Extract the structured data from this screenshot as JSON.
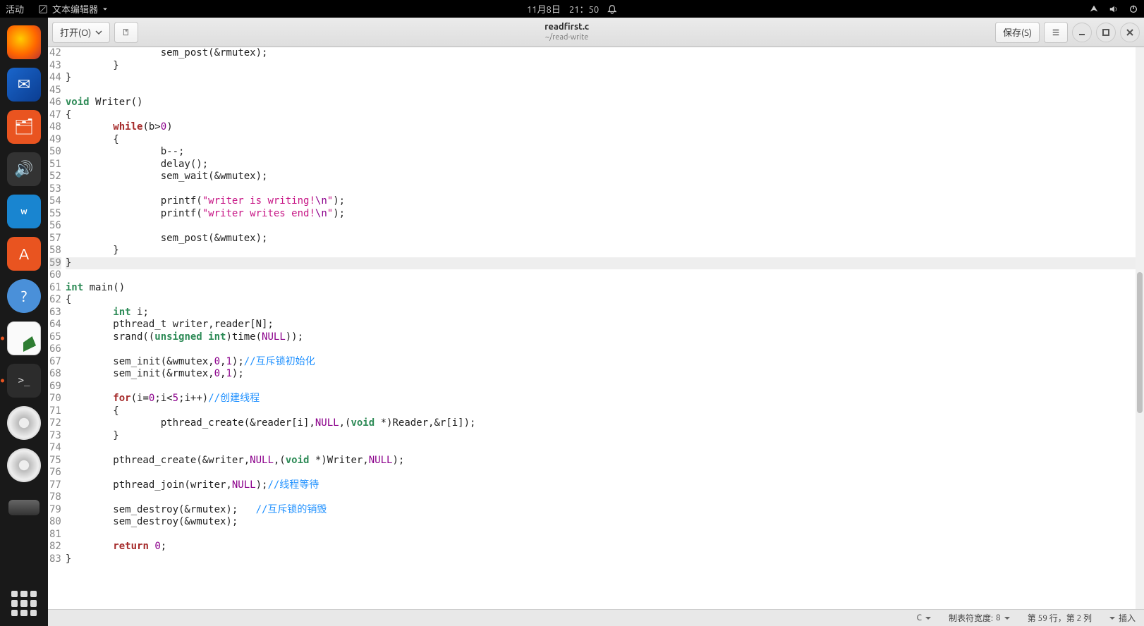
{
  "top_panel": {
    "activities": "活动",
    "app_name": "文本编辑器",
    "date": "11月8日",
    "time": "21：50"
  },
  "headerbar": {
    "open_label": "打开(O)",
    "save_label": "保存(S)",
    "filename": "readfirst.c",
    "filepath": "~/read-write"
  },
  "code_lines": [
    {
      "n": 42,
      "segments": [
        {
          "t": "\t\tsem_post(&rmutex);"
        }
      ]
    },
    {
      "n": 43,
      "segments": [
        {
          "t": "\t}"
        }
      ]
    },
    {
      "n": 44,
      "segments": [
        {
          "t": "}"
        }
      ]
    },
    {
      "n": 45,
      "segments": [
        {
          "t": ""
        }
      ]
    },
    {
      "n": 46,
      "segments": [
        {
          "t": "void",
          "c": "type"
        },
        {
          "t": " Writer()"
        }
      ]
    },
    {
      "n": 47,
      "segments": [
        {
          "t": "{"
        }
      ]
    },
    {
      "n": 48,
      "segments": [
        {
          "t": "\t"
        },
        {
          "t": "while",
          "c": "kw"
        },
        {
          "t": "(b>"
        },
        {
          "t": "0",
          "c": "num"
        },
        {
          "t": ")"
        }
      ]
    },
    {
      "n": 49,
      "segments": [
        {
          "t": "\t{"
        }
      ]
    },
    {
      "n": 50,
      "segments": [
        {
          "t": "\t\tb--;"
        }
      ]
    },
    {
      "n": 51,
      "segments": [
        {
          "t": "\t\tdelay();"
        }
      ]
    },
    {
      "n": 52,
      "segments": [
        {
          "t": "\t\tsem_wait(&wmutex);"
        }
      ]
    },
    {
      "n": 53,
      "segments": [
        {
          "t": ""
        }
      ]
    },
    {
      "n": 54,
      "segments": [
        {
          "t": "\t\tprintf("
        },
        {
          "t": "\"writer is writing!",
          "c": "str"
        },
        {
          "t": "\\n",
          "c": "esc"
        },
        {
          "t": "\"",
          "c": "str"
        },
        {
          "t": ");"
        }
      ]
    },
    {
      "n": 55,
      "segments": [
        {
          "t": "\t\tprintf("
        },
        {
          "t": "\"writer writes end!",
          "c": "str"
        },
        {
          "t": "\\n",
          "c": "esc"
        },
        {
          "t": "\"",
          "c": "str"
        },
        {
          "t": ");"
        }
      ]
    },
    {
      "n": 56,
      "segments": [
        {
          "t": ""
        }
      ]
    },
    {
      "n": 57,
      "segments": [
        {
          "t": "\t\tsem_post(&wmutex);"
        }
      ]
    },
    {
      "n": 58,
      "segments": [
        {
          "t": "\t}"
        }
      ]
    },
    {
      "n": 59,
      "hl": true,
      "segments": [
        {
          "t": "}"
        }
      ]
    },
    {
      "n": 60,
      "segments": [
        {
          "t": ""
        }
      ]
    },
    {
      "n": 61,
      "segments": [
        {
          "t": "int",
          "c": "type"
        },
        {
          "t": " main()"
        }
      ]
    },
    {
      "n": 62,
      "segments": [
        {
          "t": "{"
        }
      ]
    },
    {
      "n": 63,
      "segments": [
        {
          "t": "\t"
        },
        {
          "t": "int",
          "c": "type"
        },
        {
          "t": " i;"
        }
      ]
    },
    {
      "n": 64,
      "segments": [
        {
          "t": "\tpthread_t writer,reader[N];"
        }
      ]
    },
    {
      "n": 65,
      "segments": [
        {
          "t": "\tsrand(("
        },
        {
          "t": "unsigned int",
          "c": "type"
        },
        {
          "t": ")time("
        },
        {
          "t": "NULL",
          "c": "null"
        },
        {
          "t": "));"
        }
      ]
    },
    {
      "n": 66,
      "segments": [
        {
          "t": ""
        }
      ]
    },
    {
      "n": 67,
      "segments": [
        {
          "t": "\tsem_init(&wmutex,"
        },
        {
          "t": "0",
          "c": "num"
        },
        {
          "t": ","
        },
        {
          "t": "1",
          "c": "num"
        },
        {
          "t": ");"
        },
        {
          "t": "//互斥锁初始化",
          "c": "cmt"
        }
      ]
    },
    {
      "n": 68,
      "segments": [
        {
          "t": "\tsem_init(&rmutex,"
        },
        {
          "t": "0",
          "c": "num"
        },
        {
          "t": ","
        },
        {
          "t": "1",
          "c": "num"
        },
        {
          "t": ");"
        }
      ]
    },
    {
      "n": 69,
      "segments": [
        {
          "t": ""
        }
      ]
    },
    {
      "n": 70,
      "segments": [
        {
          "t": "\t"
        },
        {
          "t": "for",
          "c": "kw"
        },
        {
          "t": "(i="
        },
        {
          "t": "0",
          "c": "num"
        },
        {
          "t": ";i<"
        },
        {
          "t": "5",
          "c": "num"
        },
        {
          "t": ";i++)"
        },
        {
          "t": "//创建线程",
          "c": "cmt"
        }
      ]
    },
    {
      "n": 71,
      "segments": [
        {
          "t": "\t{"
        }
      ]
    },
    {
      "n": 72,
      "segments": [
        {
          "t": "\t\tpthread_create(&reader[i],"
        },
        {
          "t": "NULL",
          "c": "null"
        },
        {
          "t": ",("
        },
        {
          "t": "void",
          "c": "type"
        },
        {
          "t": " *)Reader,&r[i]);"
        }
      ]
    },
    {
      "n": 73,
      "segments": [
        {
          "t": "\t}"
        }
      ]
    },
    {
      "n": 74,
      "segments": [
        {
          "t": ""
        }
      ]
    },
    {
      "n": 75,
      "segments": [
        {
          "t": "\tpthread_create(&writer,"
        },
        {
          "t": "NULL",
          "c": "null"
        },
        {
          "t": ",("
        },
        {
          "t": "void",
          "c": "type"
        },
        {
          "t": " *)Writer,"
        },
        {
          "t": "NULL",
          "c": "null"
        },
        {
          "t": ");"
        }
      ]
    },
    {
      "n": 76,
      "segments": [
        {
          "t": ""
        }
      ]
    },
    {
      "n": 77,
      "segments": [
        {
          "t": "\tpthread_join(writer,"
        },
        {
          "t": "NULL",
          "c": "null"
        },
        {
          "t": ");"
        },
        {
          "t": "//线程等待",
          "c": "cmt"
        }
      ]
    },
    {
      "n": 78,
      "segments": [
        {
          "t": ""
        }
      ]
    },
    {
      "n": 79,
      "segments": [
        {
          "t": "\tsem_destroy(&rmutex);   "
        },
        {
          "t": "//互斥锁的销毁",
          "c": "cmt"
        }
      ]
    },
    {
      "n": 80,
      "segments": [
        {
          "t": "\tsem_destroy(&wmutex);"
        }
      ]
    },
    {
      "n": 81,
      "segments": [
        {
          "t": ""
        }
      ]
    },
    {
      "n": 82,
      "segments": [
        {
          "t": "\t"
        },
        {
          "t": "return",
          "c": "kw"
        },
        {
          "t": " "
        },
        {
          "t": "0",
          "c": "num"
        },
        {
          "t": ";"
        }
      ]
    },
    {
      "n": 83,
      "segments": [
        {
          "t": "}"
        }
      ]
    }
  ],
  "statusbar": {
    "lang": "C",
    "tabwidth_label": "制表符宽度:",
    "tabwidth_value": "8",
    "position": "第 59 行，第 2 列",
    "insert_mode": "插入"
  }
}
